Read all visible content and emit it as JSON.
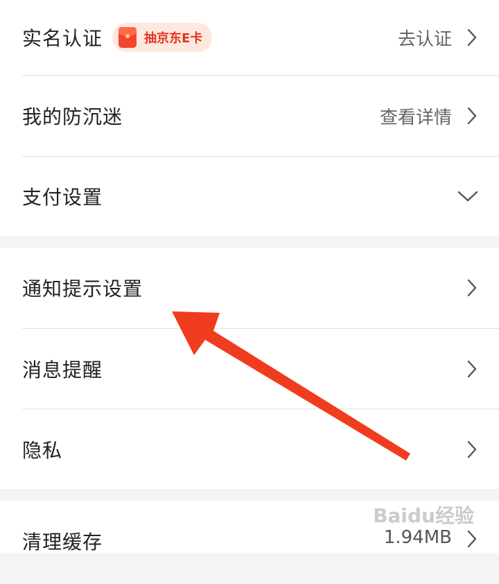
{
  "account": {
    "realname": {
      "label": "实名认证",
      "badge": "抽京东E卡",
      "value": "去认证"
    },
    "anti_addiction": {
      "label": "我的防沉迷",
      "value": "查看详情"
    },
    "payment": {
      "label": "支付设置"
    }
  },
  "notifications": {
    "notify_settings": {
      "label": "通知提示设置"
    },
    "message_reminder": {
      "label": "消息提醒"
    },
    "privacy": {
      "label": "隐私"
    }
  },
  "storage": {
    "clear_cache": {
      "label": "清理缓存",
      "value": "1.94MB"
    }
  },
  "watermark": "Baidu经验",
  "colors": {
    "annotation_arrow": "#f03c1e",
    "badge_bg": "#fde8df",
    "badge_text": "#e2341f",
    "separator_band": "#f4f4f4"
  },
  "icons": {
    "chevron_right": "chevron-right-icon",
    "chevron_down": "chevron-down-icon",
    "red_envelope": "red-envelope-icon"
  }
}
